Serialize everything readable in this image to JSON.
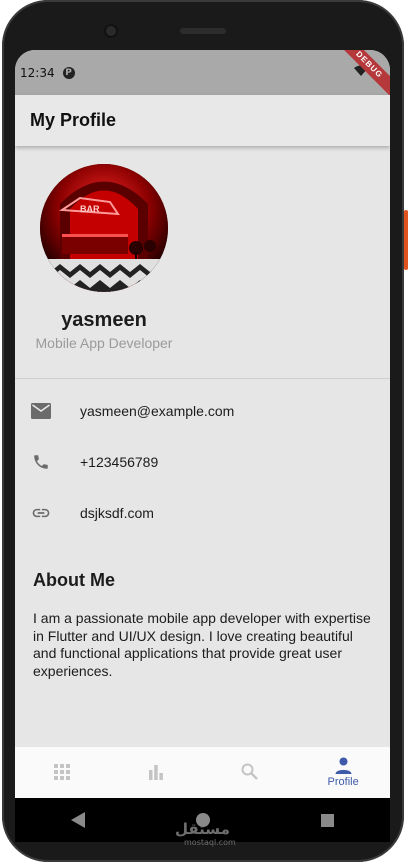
{
  "status_bar": {
    "time": "12:34",
    "notification_glyph": "P",
    "debug_banner": "DEBUG"
  },
  "app_bar": {
    "title": "My Profile"
  },
  "profile": {
    "name": "yasmeen",
    "role": "Mobile App Developer",
    "avatar_sign": "BAR"
  },
  "contacts": [
    {
      "icon": "email-icon",
      "value": "yasmeen@example.com"
    },
    {
      "icon": "phone-icon",
      "value": "+123456789"
    },
    {
      "icon": "link-icon",
      "value": "dsjksdf.com"
    }
  ],
  "about": {
    "title": "About Me",
    "body": "I am a passionate mobile app developer with expertise in Flutter and UI/UX design. I love creating beautiful and functional applications that provide great user experiences."
  },
  "bottom_nav": {
    "items": [
      {
        "icon": "grid-icon",
        "label": "",
        "active": false
      },
      {
        "icon": "bar-chart-icon",
        "label": "",
        "active": false
      },
      {
        "icon": "search-icon",
        "label": "",
        "active": false
      },
      {
        "icon": "person-icon",
        "label": "Profile",
        "active": true
      }
    ],
    "active_color": "#3f5aa8",
    "inactive_color": "#c4c4c4"
  },
  "watermark": {
    "arabic": "مستقل",
    "latin": "mostaql.com"
  },
  "colors": {
    "screen_bg": "#e6e6e6",
    "status_bar": "#a9a9a9",
    "debug_ribbon": "#b5383b",
    "accent": "#3f5aa8"
  }
}
